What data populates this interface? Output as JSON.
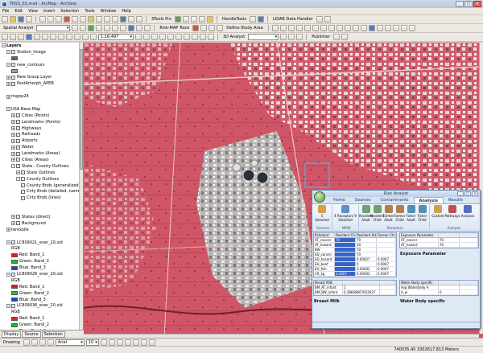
{
  "window": {
    "title": "TRSS_03.mxd - ArcMap - ArcView",
    "minimize": "_",
    "maximize": "□",
    "close": "✕"
  },
  "menu": [
    "File",
    "Edit",
    "View",
    "Insert",
    "Selection",
    "Tools",
    "Window",
    "Help"
  ],
  "toolbar1": {
    "studio_pro": "3Tools Pro",
    "handle_tools": "HandleTools",
    "lidar_handler": "LIDAR Data Handler"
  },
  "toolbar2": {
    "spatial_analyst": "Spatial Analyst",
    "risk_map_tools": "Risk-MAP Tools",
    "define_study_area": "Define Study Area"
  },
  "toolbar3": {
    "scale": "1:16,497",
    "analyst_3d": "3D Analyst",
    "publisher": "Publisher"
  },
  "toc": {
    "rows": [
      {
        "indent": 0,
        "label": "Layers",
        "exp": "−",
        "cb": false,
        "bold": true
      },
      {
        "indent": 1,
        "label": "Station_Image",
        "exp": "−",
        "cb": true
      },
      {
        "indent": 2,
        "label": "",
        "swatch": "#666666"
      },
      {
        "indent": 1,
        "label": "new_contours",
        "exp": "−",
        "cb": true
      },
      {
        "indent": 2,
        "label": "",
        "swatch": "#a0a0a0"
      },
      {
        "indent": 1,
        "label": "New Group Layer",
        "exp": "+",
        "cb": true
      },
      {
        "indent": 1,
        "label": "PestAmorph_APEB",
        "exp": "+",
        "cb": true
      },
      {
        "indent": 1,
        "label": "",
        "exp": "",
        "cb": false
      },
      {
        "indent": 1,
        "label": "risgop24",
        "exp": "+",
        "cb": false
      },
      {
        "indent": 1,
        "label": "",
        "exp": "",
        "cb": false
      },
      {
        "indent": 1,
        "label": "USA Base Map",
        "exp": "−",
        "cb": false
      },
      {
        "indent": 2,
        "label": "Cities (Points)",
        "exp": "+",
        "cb": true
      },
      {
        "indent": 2,
        "label": "Landmarks (Points)",
        "exp": "+",
        "cb": true
      },
      {
        "indent": 2,
        "label": "Highways",
        "exp": "+",
        "cb": true
      },
      {
        "indent": 2,
        "label": "Railroads",
        "exp": "+",
        "cb": true
      },
      {
        "indent": 2,
        "label": "Airports",
        "exp": "+",
        "cb": true
      },
      {
        "indent": 2,
        "label": "Water",
        "exp": "+",
        "cb": true
      },
      {
        "indent": 2,
        "label": "Landmarks (Areas)",
        "exp": "+",
        "cb": true
      },
      {
        "indent": 2,
        "label": "Cities (Areas)",
        "exp": "+",
        "cb": true
      },
      {
        "indent": 2,
        "label": "State - County Outlines",
        "exp": "−",
        "cb": true
      },
      {
        "indent": 3,
        "label": "State Outlines",
        "exp": "+",
        "cb": true
      },
      {
        "indent": 3,
        "label": "County Outlines",
        "exp": "−",
        "cb": true
      },
      {
        "indent": 4,
        "label": "County Bnds (generalized)",
        "exp": "",
        "cb": true
      },
      {
        "indent": 4,
        "label": "Cnty Bnds (detailed, named)",
        "exp": "",
        "cb": true
      },
      {
        "indent": 4,
        "label": "Cnty Bnds (lines)",
        "exp": "",
        "cb": true
      },
      {
        "indent": 2,
        "label": "",
        "exp": "",
        "cb": false
      },
      {
        "indent": 2,
        "label": "",
        "exp": "",
        "cb": false
      },
      {
        "indent": 2,
        "label": "States (direct)",
        "exp": "+",
        "cb": true
      },
      {
        "indent": 2,
        "label": "Background",
        "exp": "+",
        "cb": true
      },
      {
        "indent": 1,
        "label": "terexolle",
        "exp": "+",
        "cb": false
      },
      {
        "indent": 1,
        "label": "",
        "exp": "",
        "cb": false
      },
      {
        "indent": 1,
        "label": "LC809021_ever_20.sid",
        "exp": "−",
        "cb": true
      },
      {
        "indent": 2,
        "label": "RGB",
        "exp": "",
        "cb": false
      },
      {
        "indent": 2,
        "label": "Red: Band_1",
        "swatch": "#e02020"
      },
      {
        "indent": 2,
        "label": "Green: Band_2",
        "swatch": "#20c020"
      },
      {
        "indent": 2,
        "label": "Blue: Band_3",
        "swatch": "#2040e0"
      },
      {
        "indent": 1,
        "label": "LC809026_ever_20.sid",
        "exp": "−",
        "cb": true
      },
      {
        "indent": 2,
        "label": "RGB",
        "exp": "",
        "cb": false
      },
      {
        "indent": 2,
        "label": "Red: Band_1",
        "swatch": "#e02020"
      },
      {
        "indent": 2,
        "label": "Green: Band_2",
        "swatch": "#20c020"
      },
      {
        "indent": 2,
        "label": "Blue: Band_3",
        "swatch": "#2040e0"
      },
      {
        "indent": 1,
        "label": "LC809036_ever_20.sid",
        "exp": "−",
        "cb": true
      },
      {
        "indent": 2,
        "label": "RGB",
        "exp": "",
        "cb": false
      },
      {
        "indent": 2,
        "label": "Red: Band_1",
        "swatch": "#e02020"
      },
      {
        "indent": 2,
        "label": "Green: Band_2",
        "swatch": "#20c020"
      },
      {
        "indent": 2,
        "label": "Blue: Band_3",
        "swatch": "#2040e0"
      }
    ]
  },
  "toc_tabs": [
    "Display",
    "Source",
    "Selection"
  ],
  "drawbar": {
    "drawing": "Drawing",
    "font": "Arial",
    "size": "10"
  },
  "status": {
    "coords": "740035.45 3302617.813 Meters"
  },
  "risk_analyst": {
    "title": "Risk Analyst",
    "tabs": [
      "Home",
      "Sources",
      "Contaminants",
      "Analysis",
      "Results"
    ],
    "active_tab": "Analysis",
    "groups": [
      {
        "label": "Sources",
        "buttons": [
          "5 Selected"
        ]
      },
      {
        "label": "MIRM",
        "buttons": [
          "4 Receptors\n9 Selected"
        ]
      },
      {
        "label": "Receptors",
        "buttons": [
          "Resident\nAdult",
          "Resident\nChild",
          "Farmer\nAdult",
          "Farmer\nChild",
          "Fisher\nAdult",
          "Fisher\nChild"
        ]
      },
      {
        "label": "Analysis",
        "buttons": [
          "Custom",
          "Pathways",
          "Analysis"
        ]
      }
    ],
    "grid1": {
      "headers": [
        "Pollutant",
        "Resident Child",
        "Resident Adult",
        "Farmer Child"
      ],
      "rows": [
        [
          "AT_cancer",
          "70",
          "70",
          ""
        ],
        [
          "AT_hazard",
          "",
          "30",
          ""
        ],
        [
          "BW",
          "",
          "70",
          ""
        ],
        [
          "ED_cancer",
          "",
          "70",
          ""
        ],
        [
          "ED_hazard",
          "",
          "0.00027",
          "0.0007"
        ],
        [
          "EH_beef",
          "",
          "0",
          "0.0007"
        ],
        [
          "EH_fish",
          "",
          "0.00002",
          "0.0007"
        ],
        [
          "CR_kg",
          "0.0007",
          "0.00002",
          "0.0007"
        ]
      ]
    },
    "grid2": {
      "headers": [
        "Exposure Parameter",
        "",
        ""
      ],
      "rows": [
        [
          "AT_cancer",
          "70",
          ""
        ],
        [
          "AT_hazard",
          "70",
          ""
        ]
      ]
    },
    "exposure_title": "Exposure Parameter",
    "grid3": {
      "headers": [
        "Breast Milk",
        "",
        ""
      ],
      "rows": [
        [
          "BM_AT_infant",
          "1",
          ""
        ],
        [
          "BM_BW_infant",
          "0.38669667652627",
          ""
        ]
      ]
    },
    "grid4": {
      "headers": [
        "Water Body specific",
        "",
        ""
      ],
      "rows": [
        [
          "Avg Waterbody A",
          "",
          ""
        ],
        [
          "A_w",
          "0",
          ""
        ]
      ]
    },
    "breast_milk_title": "Breast Milk",
    "water_title": "Water Body specific"
  }
}
